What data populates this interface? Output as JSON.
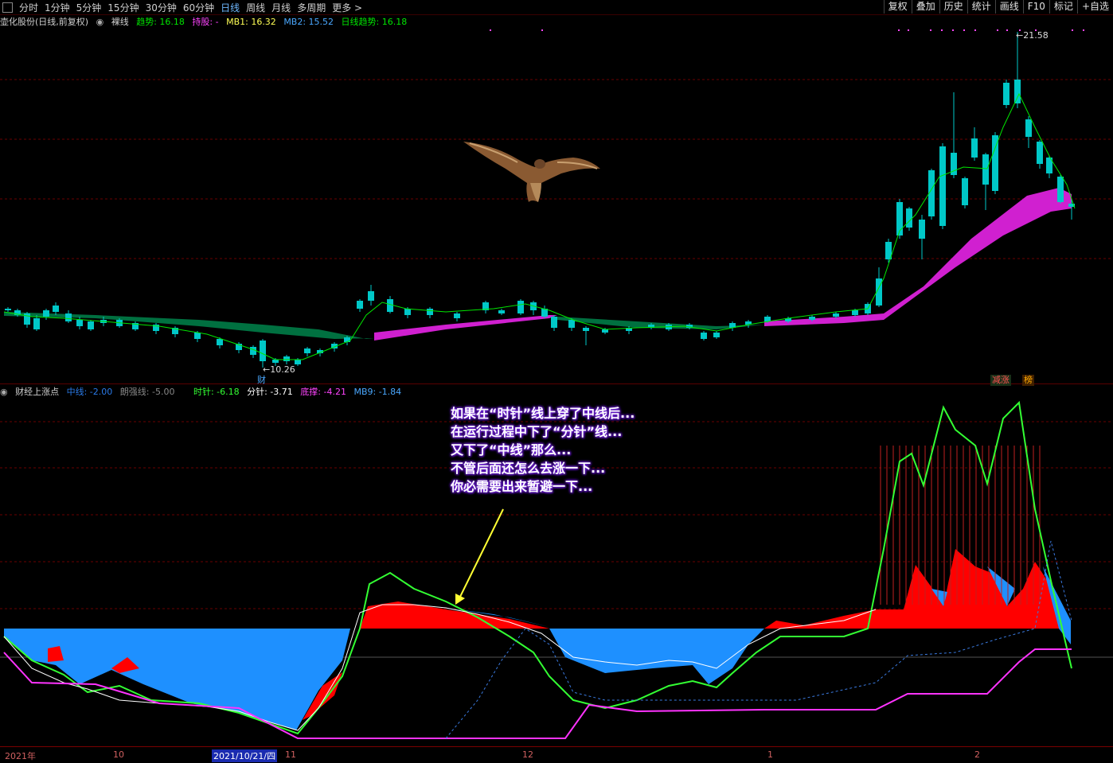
{
  "toolbar": {
    "periods": [
      "分时",
      "1分钟",
      "5分钟",
      "15分钟",
      "30分钟",
      "60分钟",
      "日线",
      "周线",
      "月线",
      "多周期",
      "更多 >"
    ],
    "active_period": "日线",
    "right_buttons": [
      "复权",
      "叠加",
      "历史",
      "统计",
      "画线",
      "F10",
      "标记",
      "+自选"
    ]
  },
  "main_info": {
    "stock": "壶化股份(日线,前复权)",
    "mode": "裸线",
    "trend_label": "趋势: 16.18",
    "hold_label": "持股: -",
    "mb1_label": "MB1: 16.32",
    "mb2_label": "MB2: 15.52",
    "day_trend_label": "日线趋势: 16.18"
  },
  "price_marks": {
    "high": "21.58",
    "low": "10.26",
    "cai": "财"
  },
  "main_badges": {
    "jian": "减涨",
    "bang": "榜"
  },
  "sub_info": {
    "name": "财经上涨点",
    "mid_label": "中线: -2.00",
    "strong_label": "朗强线: -5.00",
    "hour_label": "时针: -6.18",
    "minute_label": "分针: -3.71",
    "bottom_label": "底撑: -4.21",
    "mb9_label": "MB9: -1.84"
  },
  "annotation": [
    "如果在“时针”线上穿了中线后...",
    "在运行过程中下了“分针”线...",
    "又下了“中线”那么...",
    "不管后面还怎么去涨一下...",
    "你必需要出来暂避一下..."
  ],
  "time_axis": {
    "year": "2021年",
    "m10": "10",
    "date": "2021/10/21/四",
    "m11": "11",
    "m12": "12",
    "m1": "1",
    "m2": "2"
  },
  "colors": {
    "up": "#ff3232",
    "down": "#00c8c8",
    "trend": "#00e600",
    "band_up": "#d020d0",
    "band_down": "#007040",
    "fill_red": "#ff0000",
    "fill_blue": "#1e90ff",
    "hour_line": "#33ff33",
    "minute_line": "#ffffff",
    "bottom_line": "#ff33ff"
  }
}
